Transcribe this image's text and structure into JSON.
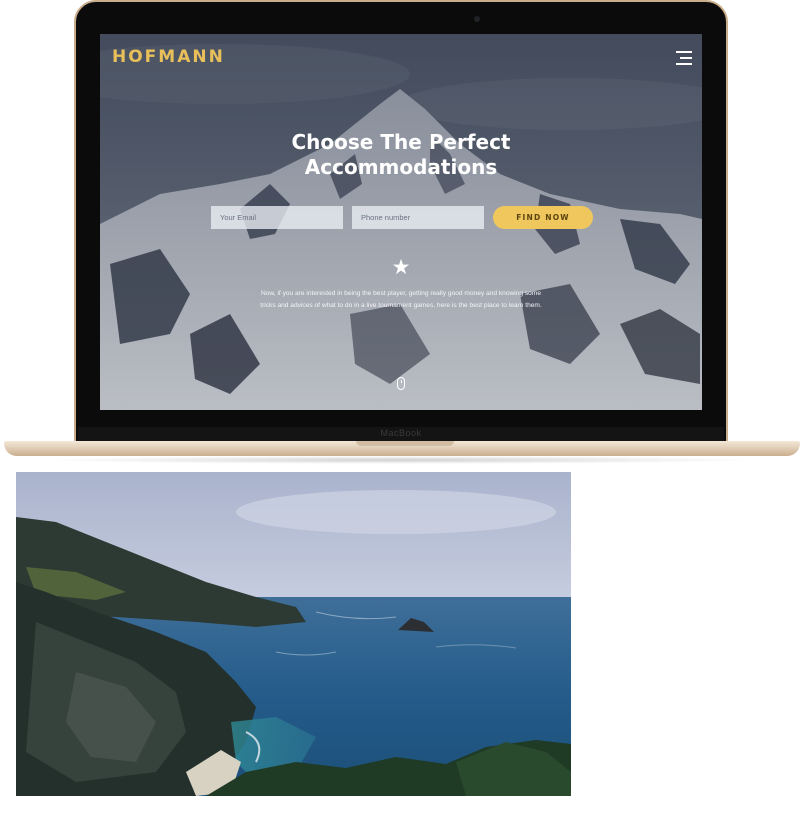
{
  "laptop": {
    "chin_label": "MacBook"
  },
  "site": {
    "brand": "HOFMANN",
    "headline_line1": "Choose The Perfect",
    "headline_line2": "Accommodations",
    "email_placeholder": "Your Email",
    "phone_placeholder": "Phone number",
    "cta_label": "FIND NOW",
    "star_glyph": "★",
    "tagline": "Now, if you are interested in being the best player, getting really good money and knowing some tricks and advices of what to do in a live tournament games, here is the best place to learn them."
  },
  "icons": {
    "menu": "hamburger-menu-icon",
    "star": "star-icon",
    "scroll": "mouse-scroll-icon"
  },
  "colors": {
    "brand": "#e9bf5a",
    "cta": "#efc75d",
    "laptop_frame": "#c9ad8b"
  }
}
